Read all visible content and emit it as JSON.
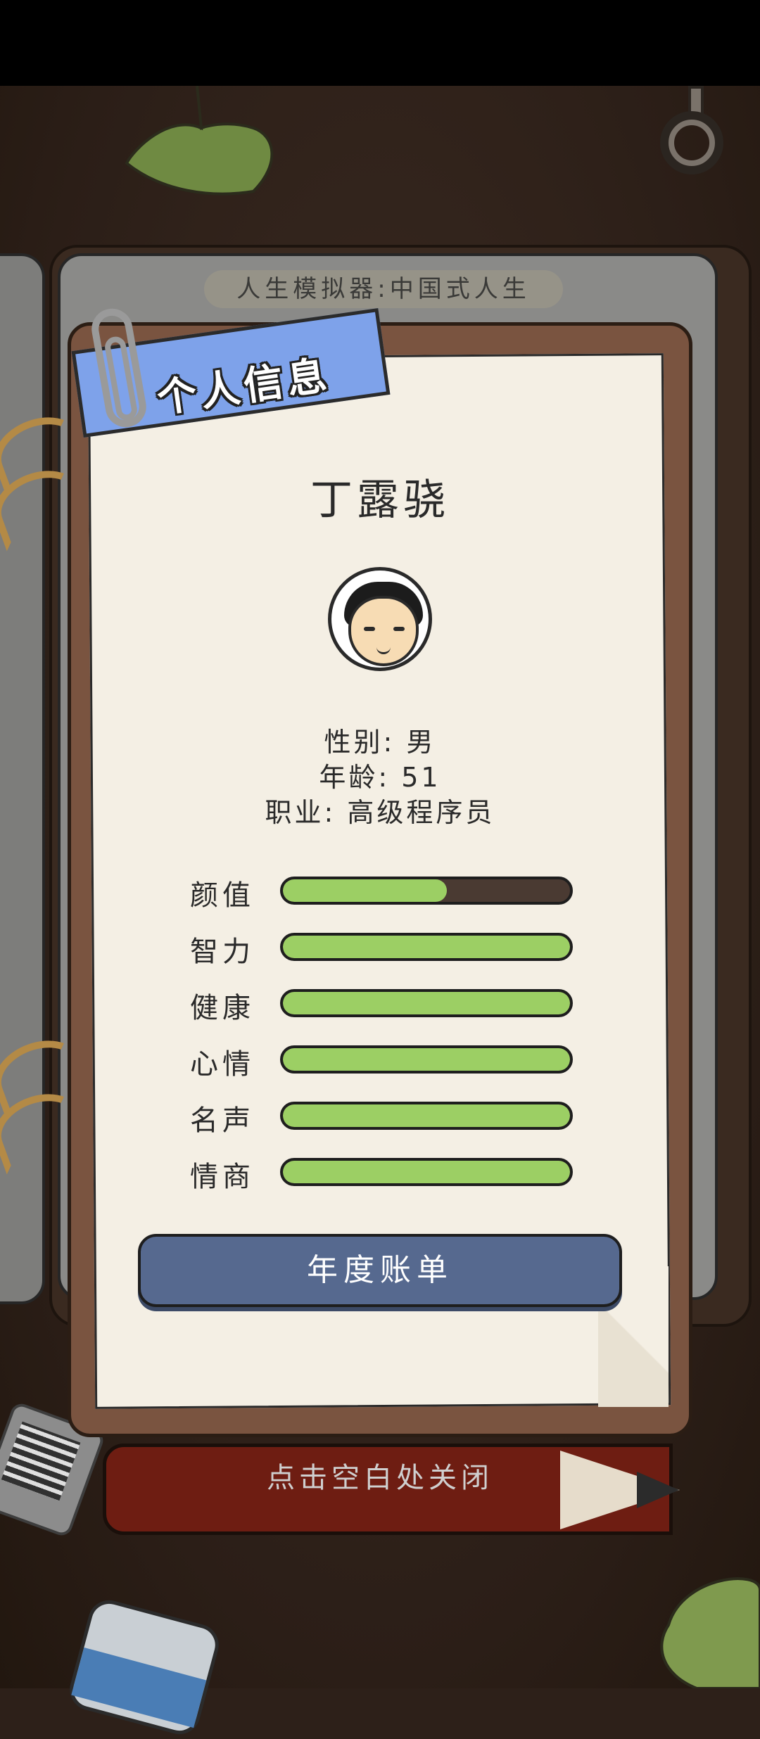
{
  "banner": {
    "title": "人生模拟器:中国式人生"
  },
  "card": {
    "header": "个人信息",
    "name": "丁露骁",
    "gender_line": "性别: 男",
    "age_line": "年龄: 51",
    "job_line": "职业: 高级程序员",
    "stats": [
      {
        "label": "颜值",
        "value": 0.57
      },
      {
        "label": "智力",
        "value": 1.0
      },
      {
        "label": "健康",
        "value": 1.0
      },
      {
        "label": "心情",
        "value": 1.0
      },
      {
        "label": "名声",
        "value": 1.0
      },
      {
        "label": "情商",
        "value": 1.0
      }
    ],
    "button": "年度账单"
  },
  "hint": {
    "close": "点击空白处关闭"
  },
  "colors": {
    "bar_fill": "#9ccf64",
    "bar_empty": "#4a3a32",
    "ribbon": "#7ea2ea",
    "button": "#56698f"
  }
}
